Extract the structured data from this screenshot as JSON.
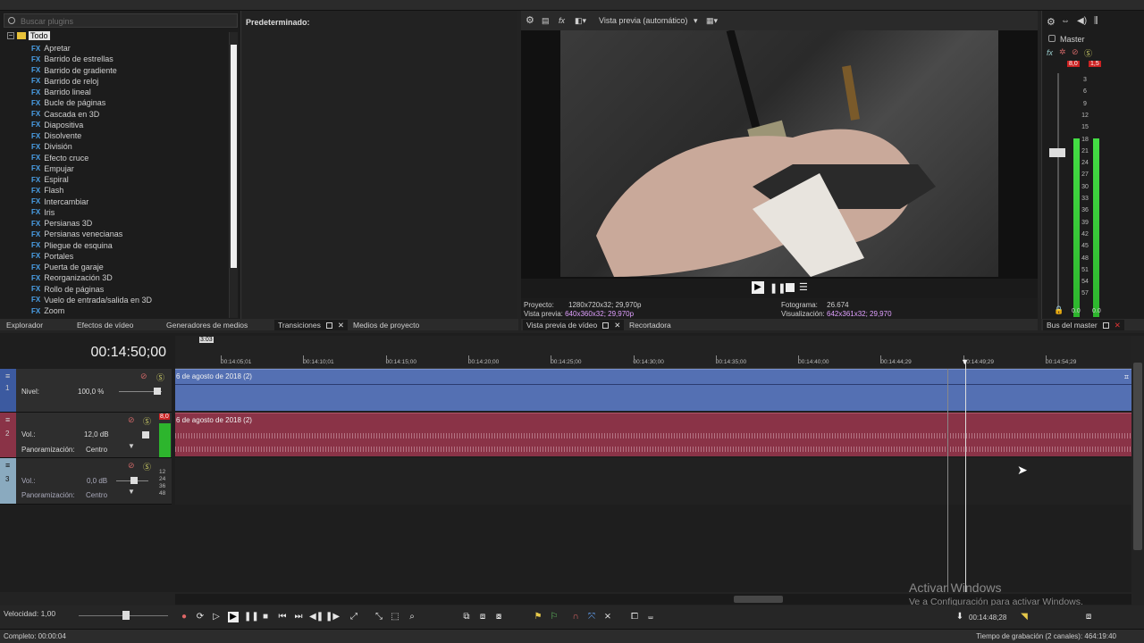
{
  "explorer": {
    "search_placeholder": "Buscar plugins",
    "root_label": "Todo",
    "items": [
      "Apretar",
      "Barrido de estrellas",
      "Barrido de gradiente",
      "Barrido de reloj",
      "Barrido lineal",
      "Bucle de páginas",
      "Cascada en 3D",
      "Diapositiva",
      "Disolvente",
      "División",
      "Efecto cruce",
      "Empujar",
      "Espiral",
      "Flash",
      "Intercambiar",
      "Iris",
      "Persianas 3D",
      "Persianas venecianas",
      "Pliegue de esquina",
      "Portales",
      "Puerta de garaje",
      "Reorganización 3D",
      "Rollo de páginas",
      "Vuelo de entrada/salida en 3D",
      "Zoom"
    ],
    "fx_badge": "FX",
    "preset_header": "Predeterminado:"
  },
  "left_tabs": [
    "Explorador",
    "Efectos de vídeo",
    "Generadores de medios",
    "Transiciones",
    "Medios de proyecto"
  ],
  "preview": {
    "mode": "Vista previa (automático)",
    "project_label": "Proyecto:",
    "project_value": "1280x720x32; 29,970p",
    "preview_label": "Vista previa:",
    "preview_value": "640x360x32; 29,970p",
    "frame_label": "Fotograma:",
    "frame_value": "26.674",
    "display_label": "Visualización:",
    "display_value": "642x361x32; 29,970",
    "tabs": [
      "Vista previa de vídeo",
      "Recortadora"
    ]
  },
  "master": {
    "title": "Master",
    "peak_left": "8,0",
    "peak_right": "1,5",
    "scale": [
      "3",
      "6",
      "9",
      "12",
      "15",
      "18",
      "21",
      "24",
      "27",
      "30",
      "33",
      "36",
      "39",
      "42",
      "45",
      "48",
      "51",
      "54",
      "57"
    ],
    "bottom_left": "0.0",
    "bottom_right": "0.0",
    "tab": "Bus del master"
  },
  "timeline": {
    "timecode": "00:14:50;00",
    "marker": "3:03",
    "ticks": [
      "00:14:05;01",
      "00:14:10;01",
      "00:14:15;00",
      "00:14:20;00",
      "00:14:25;00",
      "00:14:30;00",
      "00:14:35;00",
      "00:14:40;00",
      "00:14:44;29",
      "00:14:49;29",
      "00:14:54;29"
    ],
    "track1": {
      "num": "1",
      "level_label": "Nivel:",
      "level_value": "100,0 %",
      "clip": "6 de agosto de 2018 (2)"
    },
    "track2": {
      "num": "2",
      "vol_label": "Vol.:",
      "vol_value": "12,0 dB",
      "pan_label": "Panoramización:",
      "pan_value": "Centro",
      "peak": "8,0",
      "clip": "6 de agosto de 2018 (2)"
    },
    "track3": {
      "num": "3",
      "vol_label": "Vol.:",
      "vol_value": "0,0 dB",
      "pan_label": "Panoramización:",
      "pan_value": "Centro"
    },
    "meter_scale": [
      "12",
      "24",
      "36",
      "48"
    ]
  },
  "transport": {
    "rate_label": "Velocidad: 1,00",
    "position": "00:14:48;28"
  },
  "status": {
    "left": "Completo: 00:00:04",
    "right": "Tiempo de grabación (2 canales): 464:19:40"
  },
  "watermark": {
    "line1": "Activar Windows",
    "line2": "Ve a Configuración para activar Windows."
  }
}
